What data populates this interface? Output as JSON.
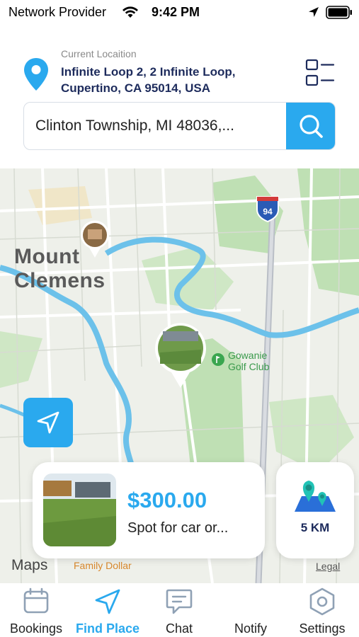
{
  "status_bar": {
    "carrier": "Network Provider",
    "time": "9:42 PM",
    "icons": [
      "wifi-icon",
      "location-arrow-icon",
      "battery-icon"
    ]
  },
  "header": {
    "location_caption": "Current Locaition",
    "location_address": "Infinite Loop 2, 2 Infinite Loop, Cupertino, CA 95014, USA",
    "list_view_icon": "list-icon"
  },
  "search": {
    "value": "Clinton Township, MI 48036,...",
    "button_icon": "search-icon"
  },
  "map": {
    "city_label": "Mount Clemens",
    "highway_shield": "94",
    "poi_label": "Gowanie Golf Club",
    "place_label": "Family Dollar",
    "attribution": "Maps",
    "legal": "Legal"
  },
  "spot_card": {
    "price": "$300.00",
    "description": "Spot for car or..."
  },
  "distance_card": {
    "label": "5 KM",
    "icon": "map-pins-icon"
  },
  "tabs": [
    {
      "label": "Bookings",
      "icon": "calendar-icon",
      "active": false
    },
    {
      "label": "Find Place",
      "icon": "navigation-arrow-icon",
      "active": true
    },
    {
      "label": "Chat",
      "icon": "chat-bubble-icon",
      "active": false
    },
    {
      "label": "Notify",
      "icon": "bell-icon",
      "active": false
    },
    {
      "label": "Settings",
      "icon": "hexagon-gear-icon",
      "active": false
    }
  ],
  "colors": {
    "accent": "#2aa9ee",
    "navy": "#1d2b5c",
    "map_water": "#6cc1ea",
    "map_park": "#bfe0b4"
  }
}
